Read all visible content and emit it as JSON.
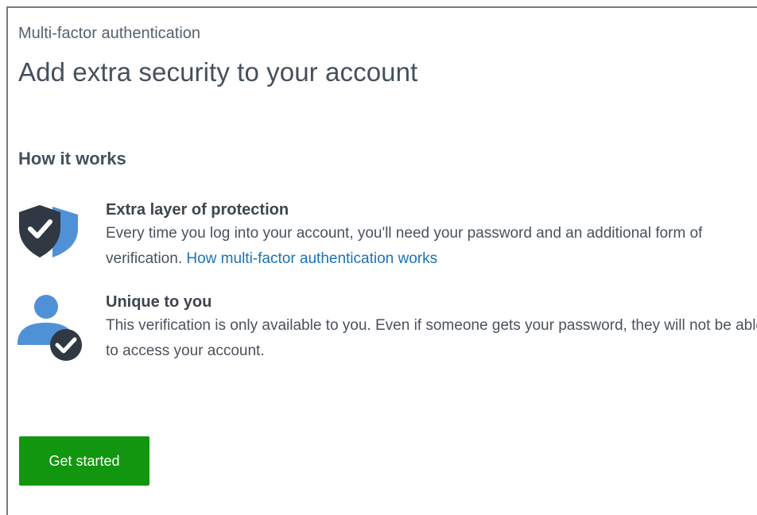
{
  "header": {
    "eyebrow": "Multi-factor authentication",
    "title": "Add extra security to your account"
  },
  "how_it_works": {
    "heading": "How it works",
    "features": [
      {
        "icon": "shield-check-icon",
        "title": "Extra layer of protection",
        "description": "Every time you log into your account, you'll need your password and an additional form of verification.",
        "link_text": "How multi-factor authentication works"
      },
      {
        "icon": "user-check-icon",
        "title": "Unique to you",
        "description": "This verification is only available to you. Even if someone gets your password, they will not be able to access your account."
      }
    ]
  },
  "actions": {
    "primary_label": "Get started"
  },
  "colors": {
    "primary_button": "#12960f",
    "link": "#1a73b8",
    "icon_dark": "#2f3843",
    "icon_light": "#4f91d6"
  }
}
